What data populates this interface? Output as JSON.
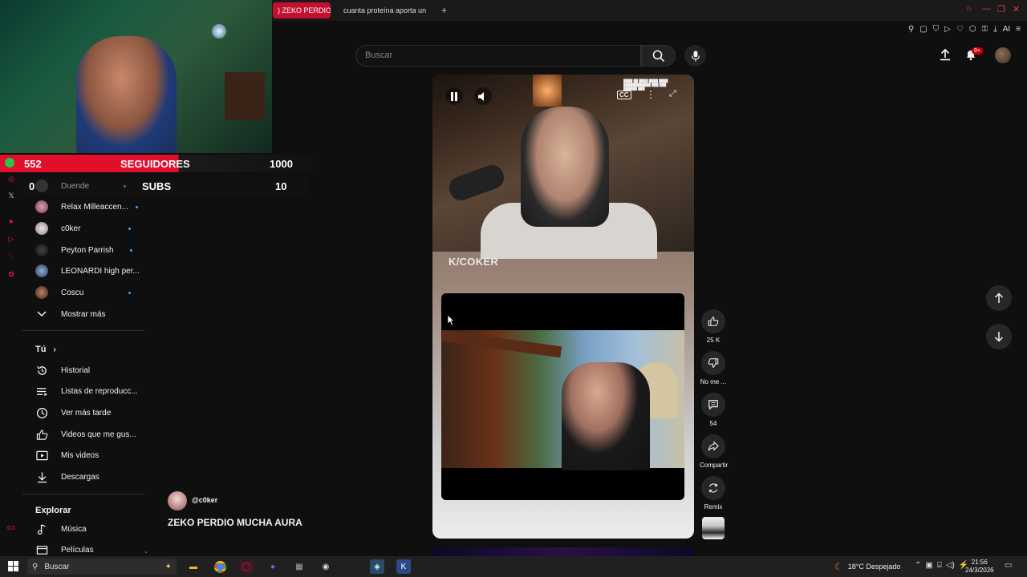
{
  "browser": {
    "tabs": [
      {
        "label": ") ZEKO PERDIO M",
        "active": true
      },
      {
        "label": "cuanta proteína aporta un",
        "active": false
      }
    ],
    "new_tab": "+",
    "ai_label": "AI"
  },
  "youtube": {
    "search_placeholder": "Buscar",
    "notification_count": "9+"
  },
  "overlay": {
    "followers_current": "552",
    "followers_label": "SEGUIDORES",
    "followers_goal": "1000",
    "subs_current": "0",
    "subs_label": "SUBS",
    "subs_goal": "10"
  },
  "sidebar": {
    "channels": [
      {
        "name": "Duende",
        "live": false
      },
      {
        "name": "Relax Milleaccen...",
        "live": true
      },
      {
        "name": "c0ker",
        "live": true
      },
      {
        "name": "Peyton Parrish",
        "live": true
      },
      {
        "name": "LEONARDI high per...",
        "live": false
      },
      {
        "name": "Coscu",
        "live": true
      }
    ],
    "show_more": "Mostrar más",
    "you_header": "Tú",
    "you_items": [
      {
        "label": "Historial",
        "icon": "history-icon"
      },
      {
        "label": "Listas de reproducc...",
        "icon": "playlists-icon"
      },
      {
        "label": "Ver más tarde",
        "icon": "watch-later-icon"
      },
      {
        "label": "Videos que me gus...",
        "icon": "liked-videos-icon"
      },
      {
        "label": "Mis videos",
        "icon": "my-videos-icon"
      },
      {
        "label": "Descargas",
        "icon": "downloads-icon"
      }
    ],
    "explore_header": "Explorar",
    "explore_items": [
      {
        "label": "Música",
        "icon": "music-icon"
      },
      {
        "label": "Películas",
        "icon": "movies-icon"
      }
    ]
  },
  "short": {
    "brand_overlay": "K/COKER",
    "cc_label": "CC",
    "channel_handle": "@c0ker",
    "title": "ZEKO PERDIO MUCHA AURA"
  },
  "actions": {
    "likes": "25 K",
    "dislike_label": "No me ...",
    "comments": "54",
    "share_label": "Compartir",
    "remix_label": "Remix"
  },
  "taskbar": {
    "search_placeholder": "Buscar",
    "weather": "18°C  Despejado",
    "time": "21:56",
    "date": "24/3/2026"
  },
  "colors": {
    "accent_red": "#e0102c",
    "youtube_bg": "#0f0f0f",
    "live_dot": "#3ea6ff"
  }
}
